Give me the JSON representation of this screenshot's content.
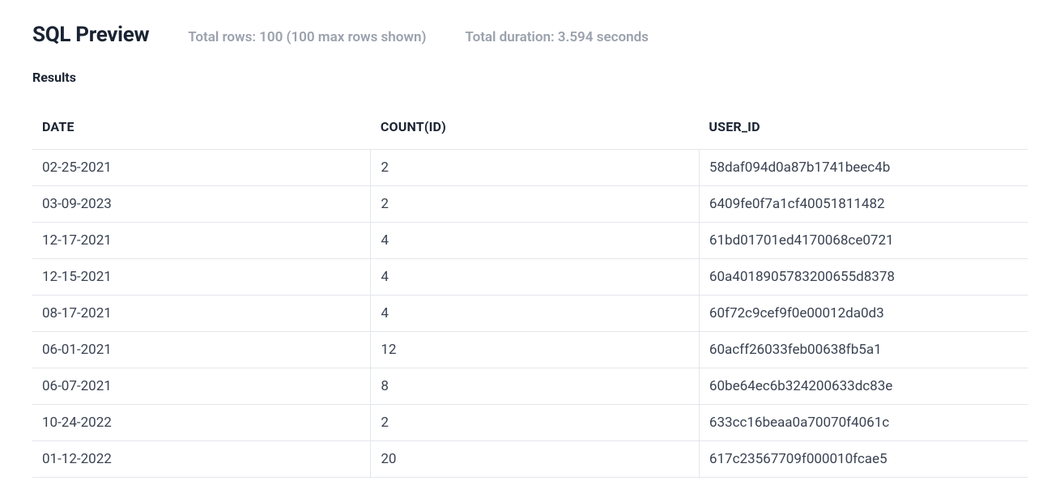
{
  "header": {
    "title": "SQL Preview",
    "total_rows": "Total rows: 100 (100 max rows shown)",
    "total_duration": "Total duration: 3.594 seconds"
  },
  "results_label": "Results",
  "table": {
    "columns": [
      "DATE",
      "COUNT(ID)",
      "USER_ID"
    ],
    "rows": [
      {
        "date": "02-25-2021",
        "count": "2",
        "user_id": "58daf094d0a87b1741beec4b"
      },
      {
        "date": "03-09-2023",
        "count": "2",
        "user_id": "6409fe0f7a1cf40051811482"
      },
      {
        "date": "12-17-2021",
        "count": "4",
        "user_id": "61bd01701ed4170068ce0721"
      },
      {
        "date": "12-15-2021",
        "count": "4",
        "user_id": "60a4018905783200655d8378"
      },
      {
        "date": "08-17-2021",
        "count": "4",
        "user_id": "60f72c9cef9f0e00012da0d3"
      },
      {
        "date": "06-01-2021",
        "count": "12",
        "user_id": "60acff26033feb00638fb5a1"
      },
      {
        "date": "06-07-2021",
        "count": "8",
        "user_id": "60be64ec6b324200633dc83e"
      },
      {
        "date": "10-24-2022",
        "count": "2",
        "user_id": "633cc16beaa0a70070f4061c"
      },
      {
        "date": "01-12-2022",
        "count": "20",
        "user_id": "617c23567709f000010fcae5"
      }
    ]
  }
}
